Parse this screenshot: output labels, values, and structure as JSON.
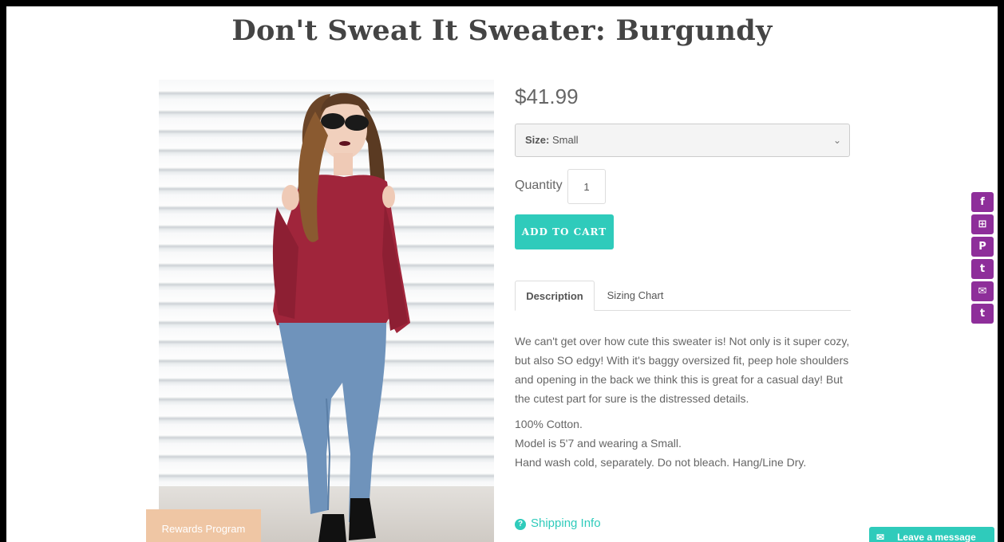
{
  "product": {
    "title": "Don't Sweat It Sweater: Burgundy",
    "price": "$41.99",
    "size_label": "Size:",
    "size_value": "Small",
    "quantity_label": "Quantity",
    "quantity_value": "1",
    "add_to_cart": "ADD TO CART"
  },
  "tabs": [
    {
      "label": "Description",
      "active": true
    },
    {
      "label": "Sizing Chart",
      "active": false
    }
  ],
  "description": {
    "paragraph": "We can't get over how cute this sweater is! Not only is it super cozy, but also SO edgy! With it's baggy oversized fit, peep hole shoulders and opening in the back we think this is great for a casual day! But the cutest part for sure is the distressed details.",
    "details": [
      "100% Cotton.",
      "Model is 5'7 and wearing a Small.",
      "Hand wash cold, separately. Do not bleach. Hang/Line Dry."
    ]
  },
  "shipping_link": "Shipping Info",
  "rewards_tab": "Rewards Program",
  "leave_message": "Leave a message",
  "share_icons": [
    "facebook-icon",
    "grid-icon",
    "pinterest-icon",
    "twitter-icon",
    "email-icon",
    "tumblr-icon"
  ],
  "share_glyphs": [
    "f",
    "⊞",
    "P",
    "t",
    "✉",
    "t"
  ],
  "colors": {
    "accent": "#2fcbbb",
    "share": "#8e2e9a",
    "rewards": "#efc6a4",
    "sweater": "#a0253b"
  }
}
